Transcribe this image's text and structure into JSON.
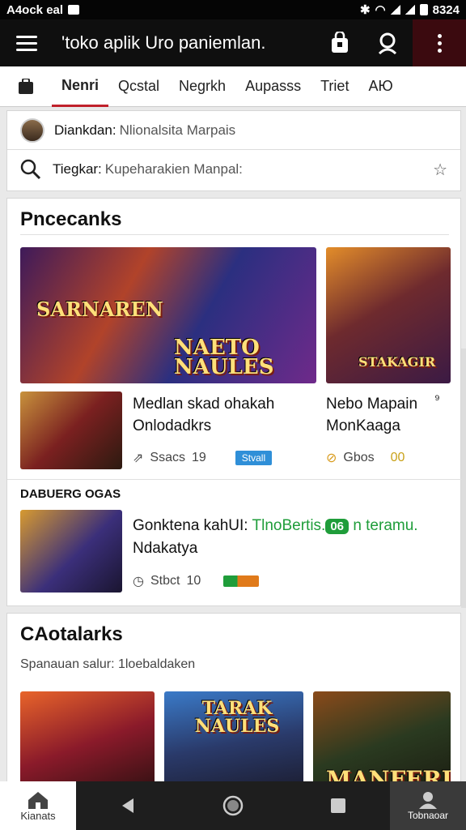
{
  "status_bar": {
    "carrier": "A4ock eal",
    "time": "8324"
  },
  "app_bar": {
    "title": "'toko aplik Uro paniemlan."
  },
  "tabs": [
    {
      "label": "Nenri",
      "active": true
    },
    {
      "label": "Qcstal",
      "active": false
    },
    {
      "label": "Negrkh",
      "active": false
    },
    {
      "label": "Aupasss",
      "active": false
    },
    {
      "label": "Triet",
      "active": false
    },
    {
      "label": "AЮ",
      "active": false
    }
  ],
  "search": {
    "row1_label": "Diankdan:",
    "row1_value": "Nlionalsita Marpais",
    "row2_label": "Tiegkar:",
    "row2_value": "Kupeharakien Manpal:"
  },
  "featured": {
    "title": "Pncecanks",
    "banner1_text_a": "SARNAREN",
    "banner1_text_b": "NAETO NAULES",
    "banner2_text": "STAKAGIR",
    "item1": {
      "title": "Medlan skad ohakah Onlodadkrs",
      "meta_label": "Ssacs",
      "meta_value": "19",
      "badge": "Stvall"
    },
    "item1b": {
      "title": "Nebo Mapain MonKaaga",
      "meta_label": "Gbos",
      "meta_value": "00"
    },
    "subheading": "DABUERG OGAS",
    "item2": {
      "title_a": "Gonktena kahUI:",
      "title_green": "TlnoBertis.",
      "badge": "06",
      "title_green_b": "n teramu.",
      "title_b": "Ndakatya",
      "meta_label": "Stbct",
      "meta_value": "10"
    }
  },
  "catalog": {
    "title": "CAotalarks",
    "subtitle": "Spanauan salur: 1loebaldaken",
    "card2_text": "TARAK NAULES",
    "card3_text": "MANFERI"
  },
  "nav": {
    "home_label": "Kianats",
    "account_label": "Tobnaoar"
  },
  "colors": {
    "accent": "#c0202a",
    "green": "#1f9d3a",
    "blue": "#2f8fd8"
  }
}
